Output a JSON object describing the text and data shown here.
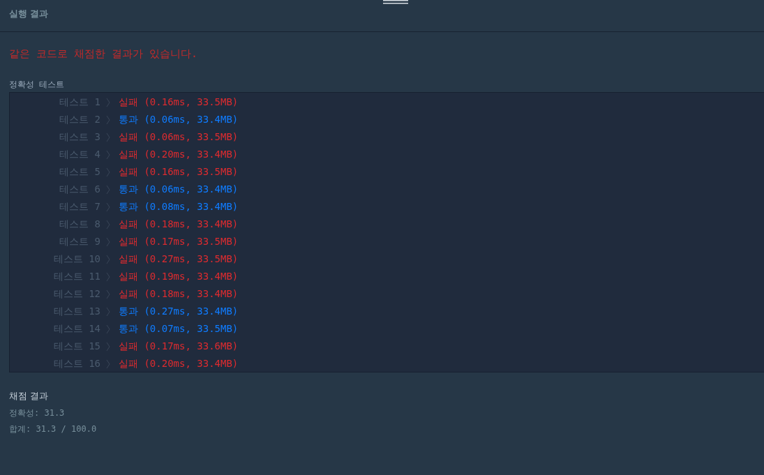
{
  "header": {
    "title": "실행 결과"
  },
  "message": "같은 코드로 채점한 결과가 있습니다.",
  "section_label": "정확성  테스트",
  "tests": [
    {
      "label": "테스트 1",
      "kind": "fail",
      "status": "실패",
      "detail": "(0.16ms, 33.5MB)"
    },
    {
      "label": "테스트 2",
      "kind": "pass",
      "status": "통과",
      "detail": "(0.06ms, 33.4MB)"
    },
    {
      "label": "테스트 3",
      "kind": "fail",
      "status": "실패",
      "detail": "(0.06ms, 33.5MB)"
    },
    {
      "label": "테스트 4",
      "kind": "fail",
      "status": "실패",
      "detail": "(0.20ms, 33.4MB)"
    },
    {
      "label": "테스트 5",
      "kind": "fail",
      "status": "실패",
      "detail": "(0.16ms, 33.5MB)"
    },
    {
      "label": "테스트 6",
      "kind": "pass",
      "status": "통과",
      "detail": "(0.06ms, 33.4MB)"
    },
    {
      "label": "테스트 7",
      "kind": "pass",
      "status": "통과",
      "detail": "(0.08ms, 33.4MB)"
    },
    {
      "label": "테스트 8",
      "kind": "fail",
      "status": "실패",
      "detail": "(0.18ms, 33.4MB)"
    },
    {
      "label": "테스트 9",
      "kind": "fail",
      "status": "실패",
      "detail": "(0.17ms, 33.5MB)"
    },
    {
      "label": "테스트 10",
      "kind": "fail",
      "status": "실패",
      "detail": "(0.27ms, 33.5MB)"
    },
    {
      "label": "테스트 11",
      "kind": "fail",
      "status": "실패",
      "detail": "(0.19ms, 33.4MB)"
    },
    {
      "label": "테스트 12",
      "kind": "fail",
      "status": "실패",
      "detail": "(0.18ms, 33.4MB)"
    },
    {
      "label": "테스트 13",
      "kind": "pass",
      "status": "통과",
      "detail": "(0.27ms, 33.4MB)"
    },
    {
      "label": "테스트 14",
      "kind": "pass",
      "status": "통과",
      "detail": "(0.07ms, 33.5MB)"
    },
    {
      "label": "테스트 15",
      "kind": "fail",
      "status": "실패",
      "detail": "(0.17ms, 33.6MB)"
    },
    {
      "label": "테스트 16",
      "kind": "fail",
      "status": "실패",
      "detail": "(0.20ms, 33.4MB)"
    }
  ],
  "summary": {
    "title": "채점 결과",
    "accuracy": "정확성: 31.3",
    "total": "합계: 31.3 / 100.0"
  }
}
